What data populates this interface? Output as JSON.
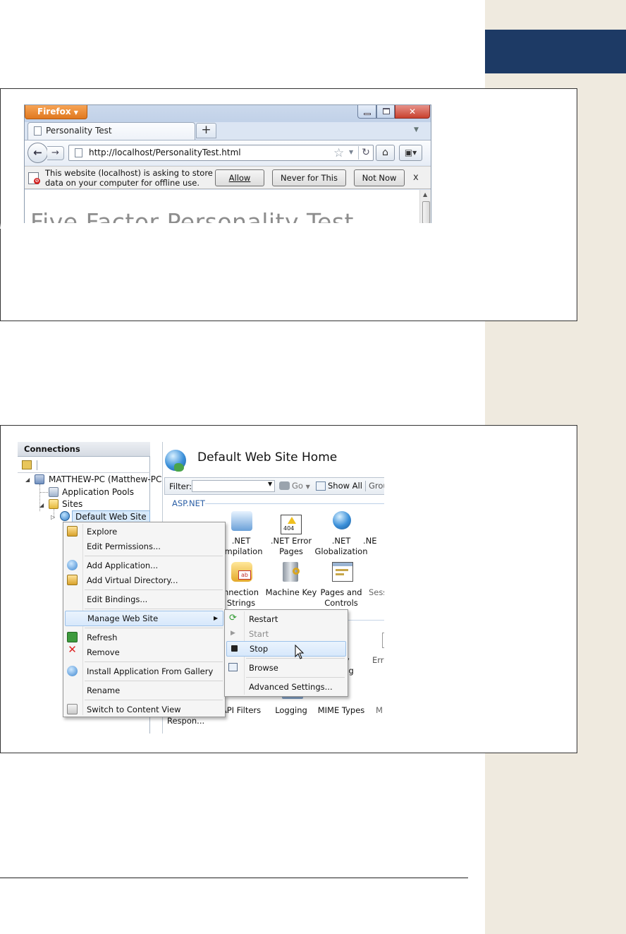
{
  "firefox": {
    "app_button": "Firefox",
    "tab_title": "Personality Test",
    "new_tab": "+",
    "url": "http://localhost/PersonalityTest.html",
    "notification": {
      "message": "This website (localhost) is asking to store data on your computer for offline use.",
      "allow": "Allow",
      "never": "Never for This Site",
      "not_now": "Not Now",
      "close": "x"
    },
    "page_heading": "Five Factor Personality Test"
  },
  "iis": {
    "connections": {
      "header": "Connections",
      "tree": {
        "server": "MATTHEW-PC (Matthew-PC",
        "app_pools": "Application Pools",
        "sites": "Sites",
        "default_site": "Default Web Site"
      }
    },
    "main": {
      "title": "Default Web Site Home",
      "filter_label": "Filter:",
      "go": "Go",
      "show_all": "Show All",
      "group": "Grou",
      "section": "ASP.NET",
      "features": [
        {
          "label": ".NET\nompilation"
        },
        {
          "label": ".NET Error\nPages"
        },
        {
          "label": ".NET\nGlobalization"
        },
        {
          "label": ".NE"
        },
        {
          "label": "nnection\nStrings"
        },
        {
          "label": "Machine Key"
        },
        {
          "label": "Pages and\nControls"
        },
        {
          "label": "Sess"
        },
        {
          "label": "ry\ning"
        },
        {
          "label": "Erro"
        },
        {
          "label": "API Filters"
        },
        {
          "label": "Logging"
        },
        {
          "label": "MIME Types"
        },
        {
          "label": "M"
        },
        {
          "label": "Respon..."
        }
      ]
    },
    "context_menu": {
      "explore": "Explore",
      "edit_permissions": "Edit Permissions...",
      "add_application": "Add Application...",
      "add_virtual_directory": "Add Virtual Directory...",
      "edit_bindings": "Edit Bindings...",
      "manage_web_site": "Manage Web Site",
      "refresh": "Refresh",
      "remove": "Remove",
      "install_from_gallery": "Install Application From Gallery",
      "rename": "Rename",
      "switch_content_view": "Switch to Content View"
    },
    "submenu": {
      "restart": "Restart",
      "start": "Start",
      "stop": "Stop",
      "browse": "Browse",
      "advanced_settings": "Advanced Settings..."
    }
  },
  "colors": {
    "side_strip": "#efeadf",
    "side_tab": "#1d3a65",
    "firefox_orange": "#e0781f",
    "menu_highlight": "#d7e8fb",
    "section_blue": "#2b5fa6"
  }
}
